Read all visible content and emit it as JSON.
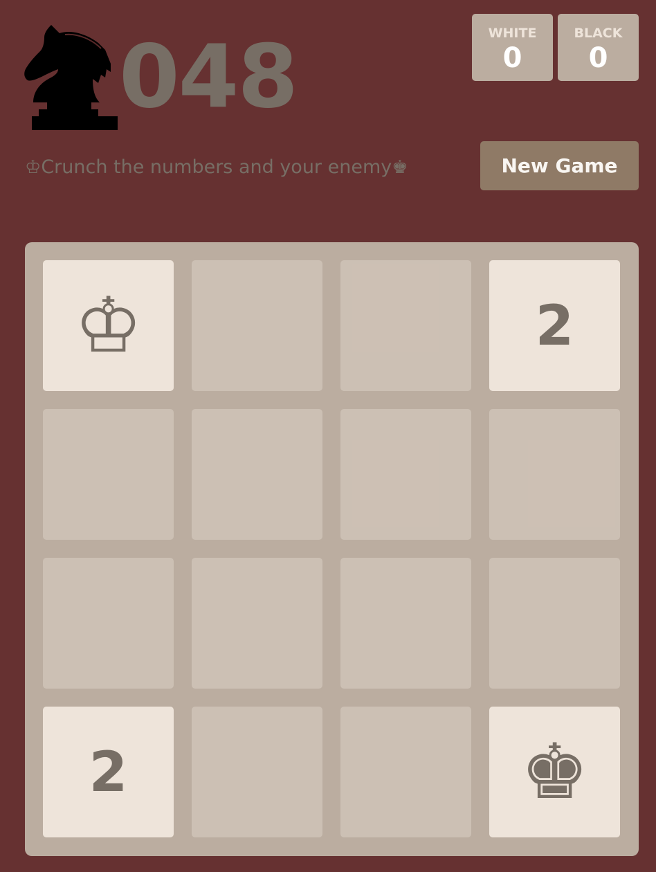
{
  "header": {
    "logo": {
      "icon": "black-knight-icon",
      "glyph": "♞",
      "color": "#000000"
    },
    "title_number": "048"
  },
  "scores": {
    "white": {
      "label": "WHITE",
      "value": "0"
    },
    "black": {
      "label": "BLACK",
      "value": "0"
    }
  },
  "intro": {
    "lead_piece": "♔",
    "text": "Crunch the numbers and your enemy",
    "trail_piece": "♚"
  },
  "controls": {
    "new_game_label": "New Game"
  },
  "board": {
    "size": 4,
    "tiles": [
      {
        "row": 0,
        "col": 0,
        "value": "♔",
        "kind": "piece",
        "icon": "white-king-icon"
      },
      {
        "row": 0,
        "col": 3,
        "value": "2",
        "kind": "number"
      },
      {
        "row": 3,
        "col": 0,
        "value": "2",
        "kind": "number"
      },
      {
        "row": 3,
        "col": 3,
        "value": "♚",
        "kind": "piece",
        "icon": "black-king-icon"
      }
    ]
  },
  "colors": {
    "background": "#663131",
    "board": "#bbada0",
    "empty_cell": "#cdc1b4",
    "tile": "#eee4da",
    "text": "#776e65",
    "button": "#8f7a66"
  }
}
